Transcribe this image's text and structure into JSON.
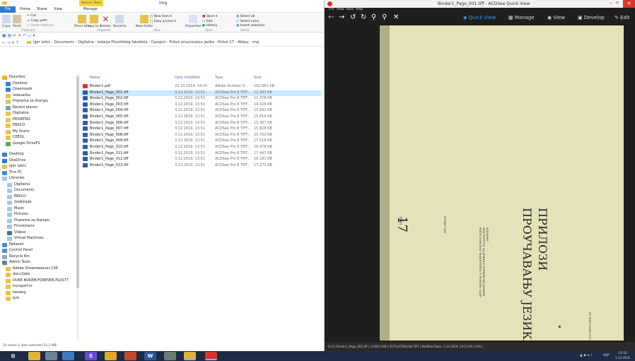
{
  "explorer": {
    "title": "img",
    "contextual_tab": "Picture Tools",
    "tabs": [
      "File",
      "Home",
      "Share",
      "View",
      "Manage"
    ],
    "ribbon": {
      "clipboard": {
        "label": "Clipboard",
        "copy": "Copy",
        "paste": "Paste",
        "cut": "Cut",
        "copy_path": "Copy path",
        "paste_shortcut": "Paste shortcut"
      },
      "organize": {
        "label": "Organize",
        "move_to": "Move to ▾",
        "copy_to": "Copy to ▾",
        "delete": "Delete",
        "rename": "Rename"
      },
      "new": {
        "label": "New",
        "new_folder": "New folder",
        "new_item": "New item ▾",
        "easy_access": "Easy access ▾"
      },
      "open": {
        "label": "Open",
        "properties": "Properties",
        "open": "Open ▾",
        "edit": "Edit",
        "history": "History"
      },
      "select": {
        "label": "Select",
        "select_all": "Select all",
        "select_none": "Select none",
        "invert": "Invert selection"
      }
    },
    "breadcrumb": [
      "Igor Lekić",
      "Documents",
      "Digitalna",
      "Izdanja Filozofskog fakulteta",
      "Časopisi",
      "Prilozi proučavanju jezika",
      "Prilozi 17",
      "Abbyy",
      "img"
    ],
    "columns": {
      "name": "Name",
      "date": "Date modified",
      "type": "Type",
      "size": "Size"
    },
    "files": [
      {
        "name": "Binder1.pdf",
        "date": "22.10.2019. 14:15",
        "type": "Adobe Acrobat D...",
        "size": "102.861 KB",
        "kind": "pdf"
      },
      {
        "name": "Binder1_Page_001.tiff",
        "date": "3.12.2019. 13:51",
        "type": "ACDSee Pro 8 TIFF...",
        "size": "11.393 KB",
        "kind": "tiff"
      },
      {
        "name": "Binder1_Page_002.tiff",
        "date": "3.12.2019. 13:51",
        "type": "ACDSee Pro 8 TIFF...",
        "size": "11.378 KB",
        "kind": "tiff"
      },
      {
        "name": "Binder1_Page_003.tiff",
        "date": "3.12.2019. 13:51",
        "type": "ACDSee Pro 8 TIFF...",
        "size": "14.026 KB",
        "kind": "tiff"
      },
      {
        "name": "Binder1_Page_004.tiff",
        "date": "3.12.2019. 13:51",
        "type": "ACDSee Pro 8 TIFF...",
        "size": "15.692 KB",
        "kind": "tiff"
      },
      {
        "name": "Binder1_Page_005.tiff",
        "date": "3.12.2019. 13:51",
        "type": "ACDSee Pro 8 TIFF...",
        "size": "15.814 KB",
        "kind": "tiff"
      },
      {
        "name": "Binder1_Page_006.tiff",
        "date": "3.12.2019. 13:51",
        "type": "ACDSee Pro 8 TIFF...",
        "size": "15.307 KB",
        "kind": "tiff"
      },
      {
        "name": "Binder1_Page_007.tiff",
        "date": "3.12.2019. 13:51",
        "type": "ACDSee Pro 8 TIFF...",
        "size": "15.828 KB",
        "kind": "tiff"
      },
      {
        "name": "Binder1_Page_008.tiff",
        "date": "3.12.2019. 13:51",
        "type": "ACDSee Pro 8 TIFF...",
        "size": "15.702 KB",
        "kind": "tiff"
      },
      {
        "name": "Binder1_Page_009.tiff",
        "date": "3.12.2019. 13:51",
        "type": "ACDSee Pro 8 TIFF...",
        "size": "17.518 KB",
        "kind": "tiff"
      },
      {
        "name": "Binder1_Page_010.tiff",
        "date": "3.12.2019. 13:51",
        "type": "ACDSee Pro 8 TIFF...",
        "size": "16.476 KB",
        "kind": "tiff"
      },
      {
        "name": "Binder1_Page_011.tiff",
        "date": "3.12.2019. 13:51",
        "type": "ACDSee Pro 8 TIFF...",
        "size": "17.443 KB",
        "kind": "tiff"
      },
      {
        "name": "Binder1_Page_012.tiff",
        "date": "3.12.2019. 13:51",
        "type": "ACDSee Pro 8 TIFF...",
        "size": "16.181 KB",
        "kind": "tiff"
      },
      {
        "name": "Binder1_Page_013.tiff",
        "date": "3.12.2019. 13:51",
        "type": "ACDSee Pro 8 TIFF...",
        "size": "17.271 KB",
        "kind": "tiff"
      }
    ],
    "nav": [
      {
        "label": "Favorites",
        "kind": "star"
      },
      {
        "label": "Desktop",
        "kind": "desk"
      },
      {
        "label": "Downloads",
        "kind": "dl"
      },
      {
        "label": "Izdavačka",
        "kind": "folder"
      },
      {
        "label": "Priprema za štampu",
        "kind": "folder"
      },
      {
        "label": "Recent places",
        "kind": "recent"
      },
      {
        "label": "Digitalna",
        "kind": "folder"
      },
      {
        "label": "PRIVATNO",
        "kind": "folder"
      },
      {
        "label": "EBSCO",
        "kind": "folder"
      },
      {
        "label": "My Scans",
        "kind": "folder"
      },
      {
        "label": "CEEOL",
        "kind": "folder"
      },
      {
        "label": "Google DriveFS",
        "kind": "drive"
      },
      {
        "label": "",
        "kind": "gap"
      },
      {
        "label": "Desktop",
        "kind": "desk"
      },
      {
        "label": "OneDrive",
        "kind": "cloud"
      },
      {
        "label": "Igor Lekić",
        "kind": "user"
      },
      {
        "label": "This PC",
        "kind": "pc"
      },
      {
        "label": "Libraries",
        "kind": "lib"
      },
      {
        "label": "Digitalna",
        "kind": "lib"
      },
      {
        "label": "Documents",
        "kind": "lib"
      },
      {
        "label": "EBSCO",
        "kind": "lib"
      },
      {
        "label": "Godišnjak",
        "kind": "lib"
      },
      {
        "label": "Music",
        "kind": "music"
      },
      {
        "label": "Pictures",
        "kind": "lib"
      },
      {
        "label": "Priprema za štampu",
        "kind": "lib"
      },
      {
        "label": "Privremeno",
        "kind": "lib"
      },
      {
        "label": "Videos",
        "kind": "video"
      },
      {
        "label": "Virtual Machines",
        "kind": "lib"
      },
      {
        "label": "Network",
        "kind": "net"
      },
      {
        "label": "Control Panel",
        "kind": "cp"
      },
      {
        "label": "Recycle Bin",
        "kind": "bin"
      },
      {
        "label": "Admin Tools",
        "kind": "admin"
      },
      {
        "label": "Adobe Dreamweaver CS6",
        "kind": "folder"
      },
      {
        "label": "docu2jats",
        "kind": "folder"
      },
      {
        "label": "DUKE.NUKEM.FOREVER.PLUS77",
        "kind": "folder"
      },
      {
        "label": "hunspell-sr",
        "kind": "folder"
      },
      {
        "label": "katalog",
        "kind": "folder"
      },
      {
        "label": "lpm",
        "kind": "folder"
      }
    ],
    "status": "14 items   1 item selected  11,1 MB"
  },
  "quickview": {
    "title": "Binder1_Page_001.tiff - ACDSee Quick View",
    "menu": [
      "File",
      "View",
      "Tools",
      "Help"
    ],
    "modes": [
      "Quick View",
      "Manage",
      "View",
      "Develop",
      "Edit"
    ],
    "status": "1/13  |  Binder1_Page_001.tiff  |  11392.4 KB  |  2575x3700x24b TIFF  |  Modified Date: 3.12.2019. 13:51:29  |  24%  |",
    "page_text": {
      "title_line1": "ПРИЛОЗИ",
      "title_line2": "ПРОУЧАВАЊУ ЈЕЗИКА",
      "volume": "17",
      "year": "1981",
      "inst1": "ИЗДАЊЕ",
      "inst2": "ИНСТИТУТА ЗА ЈУЖНОСЛОВЕНСКЕ ЈЕЗИКЕ",
      "inst3": "ФИЛОЗОФСКОГ ФАКУЛТЕТА У НОВОМ САДУ",
      "city": "НОВИ САД",
      "code": "YU ISSN 0555-1137"
    }
  },
  "taskbar": {
    "tray_lang": "SRP",
    "clock_time": "13:52",
    "clock_date": "3.12.2019."
  },
  "colors": {
    "ribbon_blue": "#2b7bd2",
    "picture_tools": "#f0c000",
    "qv_bg": "#1e1e1e",
    "accent_blue": "#2f9af2",
    "page_paper": "#e5e2b9",
    "close_red": "#d9342b"
  }
}
